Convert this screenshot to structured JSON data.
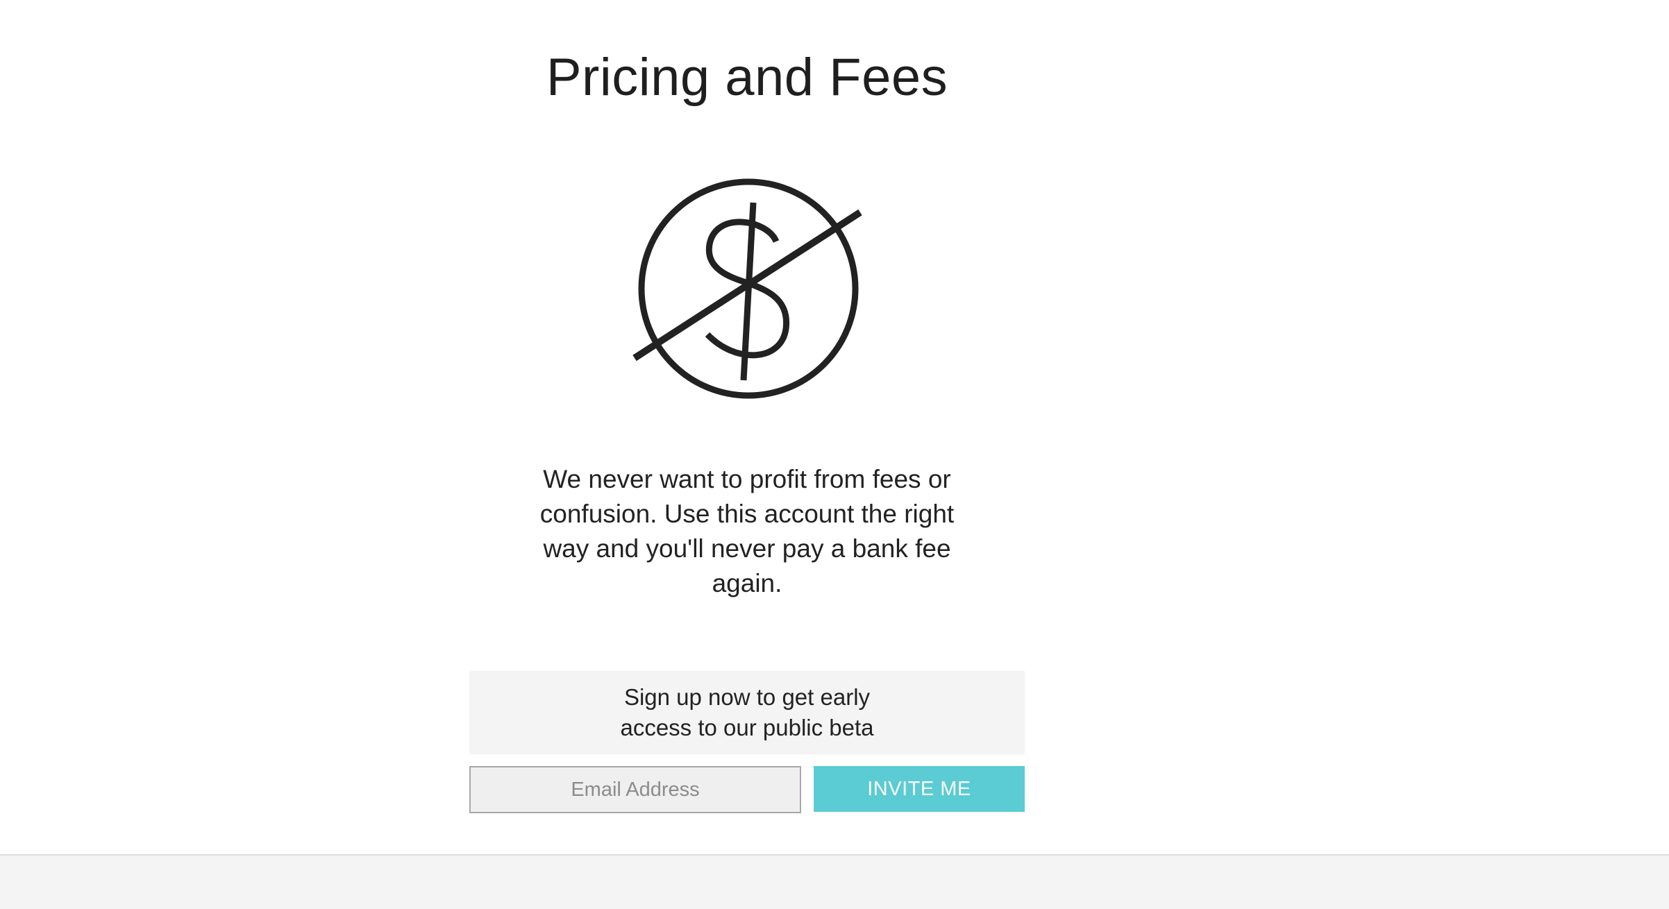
{
  "header": {
    "title": "Pricing and Fees"
  },
  "icon": {
    "name": "no-dollar-icon",
    "color": "#222222"
  },
  "main": {
    "description": "We never want to profit from fees or confusion. Use this account the right way and you'll never pay a bank fee again."
  },
  "signup": {
    "prompt": "Sign up now to get early access to our public beta",
    "email_value": "",
    "email_placeholder": "Email Address",
    "button_label": "INVITE ME",
    "button_color": "#5bcbd4",
    "box_color": "#f4f4f4"
  }
}
